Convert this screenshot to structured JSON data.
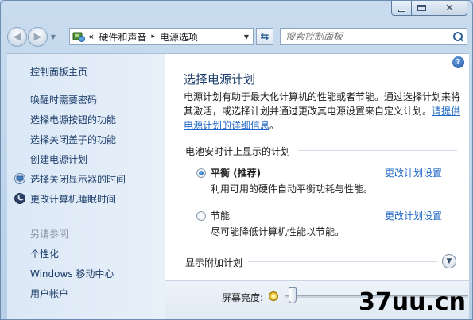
{
  "window": {
    "caption_buttons": {
      "minimize": "minimize-icon",
      "maximize": "maximize-icon",
      "close": "close-icon"
    }
  },
  "toolbar": {
    "address_icon": "control-panel-icon",
    "address_prefix": "«",
    "breadcrumb": [
      "硬件和声音",
      "电源选项"
    ],
    "separator": "▸",
    "search_placeholder": "搜索控制面板"
  },
  "sidebar": {
    "home": "控制面板主页",
    "links": [
      {
        "label": "唤醒时需要密码",
        "icon": ""
      },
      {
        "label": "选择电源按钮的功能",
        "icon": ""
      },
      {
        "label": "选择关闭盖子的功能",
        "icon": ""
      },
      {
        "label": "创建电源计划",
        "icon": ""
      },
      {
        "label": "选择关闭显示器的时间",
        "icon": "monitor-icon"
      },
      {
        "label": "更改计算机睡眠时间",
        "icon": "sleep-moon-icon"
      }
    ],
    "see_also_heading": "另请参阅",
    "see_also": [
      "个性化",
      "Windows 移动中心",
      "用户帐户"
    ]
  },
  "main": {
    "title": "选择电源计划",
    "intro_text": "电源计划有助于最大化计算机的性能或者节能。通过选择计划来将其激活，或选择计划并通过更改其电源设置来自定义计划。",
    "intro_link": "请提供电源计划的详细信息",
    "intro_end": "。",
    "section_battery": "电池安时计上显示的计划",
    "plans": [
      {
        "name": "平衡 (推荐)",
        "desc": "利用可用的硬件自动平衡功耗与性能。",
        "link": "更改计划设置",
        "selected": true
      },
      {
        "name": "节能",
        "desc": "尽可能降低计算机性能以节能。",
        "link": "更改计划设置",
        "selected": false
      }
    ],
    "section_more": "显示附加计划",
    "brightness_label": "屏幕亮度:",
    "brightness_level": 0.02
  },
  "watermark": "37uu.cn",
  "colors": {
    "link": "#1f67c7",
    "sidebar_bg": "#e0ebf7",
    "title": "#1e3f6b"
  }
}
